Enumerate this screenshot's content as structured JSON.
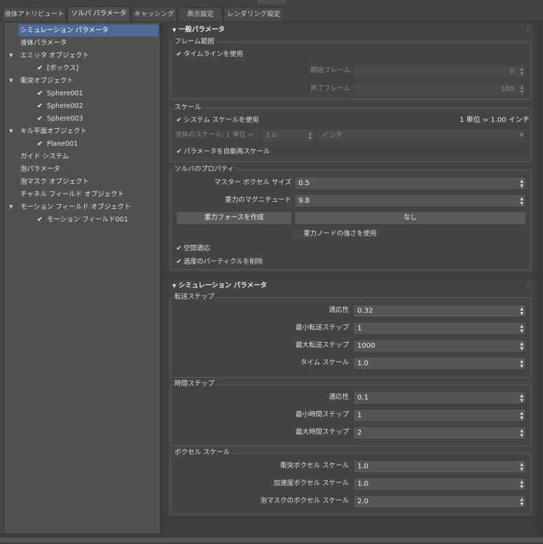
{
  "tabs": [
    "液体アトリビュート",
    "ソルバ パラメータ",
    "キャッシング",
    "表示設定",
    "レンダリング設定"
  ],
  "tree": {
    "simulation_params": "シミュレーション パラメータ",
    "liquid_params": "液体パラメータ",
    "emitter_objects": "エミッタ オブジェクト",
    "box": "[ボックス]",
    "collision_objects": "衝突オブジェクト",
    "sphere1": "Sphere001",
    "sphere2": "Sphere002",
    "sphere3": "Sphere003",
    "kill_plane_objects": "キル平面オブジェクト",
    "plane1": "Plane001",
    "guide_system": "ガイド システム",
    "foam_params": "泡パラメータ",
    "foam_mask_object": "泡マスク オブジェクト",
    "channel_field_object": "チャネル フィールド オブジェクト",
    "motion_field_objects": "モーション フィールド オブジェクト",
    "motion_field1": "モーション フィールド001"
  },
  "general": {
    "title": "一般パラメータ",
    "frame_range": {
      "title": "フレーム範囲",
      "use_timeline": "タイムラインを使用",
      "start_label": "開始フレーム",
      "start_value": "0",
      "end_label": "終了フレーム",
      "end_value": "100"
    },
    "scale": {
      "title": "スケール",
      "use_system_scale": "システム スケールを使用",
      "unit_info": "1 単位 = 1.00 インチ",
      "fluid_scale_label": "流体のスケール: 1 単位 =",
      "fluid_scale_value": "1.0",
      "unit_value": "インチ",
      "auto_rescale": "パラメータを自動再スケール"
    },
    "solver": {
      "title": "ソルバのプロパティ",
      "voxel_size_label": "マスター ボクセル サイズ",
      "voxel_size_value": "0.5",
      "gravity_label": "重力のマグニチュード",
      "gravity_value": "9.8",
      "create_gravity": "重力フォースを作成",
      "gravity_node": "なし",
      "use_gravity_node": "重力ノードの強さを使用",
      "spatial_adapt": "空間適応",
      "remove_excess": "過度のパーティクルを削除"
    }
  },
  "simulation": {
    "title": "シミュレーション パラメータ",
    "transport": {
      "title": "転送ステップ",
      "rows": [
        {
          "label": "適応性",
          "value": "0.32"
        },
        {
          "label": "最小転送ステップ",
          "value": "1"
        },
        {
          "label": "最大転送ステップ",
          "value": "1000"
        },
        {
          "label": "タイム スケール",
          "value": "1.0"
        }
      ]
    },
    "time": {
      "title": "時間ステップ",
      "rows": [
        {
          "label": "適応性",
          "value": "0.1"
        },
        {
          "label": "最小時間ステップ",
          "value": "1"
        },
        {
          "label": "最大時間ステップ",
          "value": "2"
        }
      ]
    },
    "voxel": {
      "title": "ボクセル スケール",
      "rows": [
        {
          "label": "衝突ボクセル スケール",
          "value": "1.0"
        },
        {
          "label": "加速度ボクセル スケール",
          "value": "1.0"
        },
        {
          "label": "泡マスクのボクセル スケール",
          "value": "2.0"
        }
      ]
    }
  },
  "icons": {
    "check": "check-icon",
    "expand": "triangle-down-icon",
    "spinner": "spinner-arrows-icon",
    "dropdown": "dropdown-arrow-icon",
    "grip": "panel-grip-icon"
  }
}
